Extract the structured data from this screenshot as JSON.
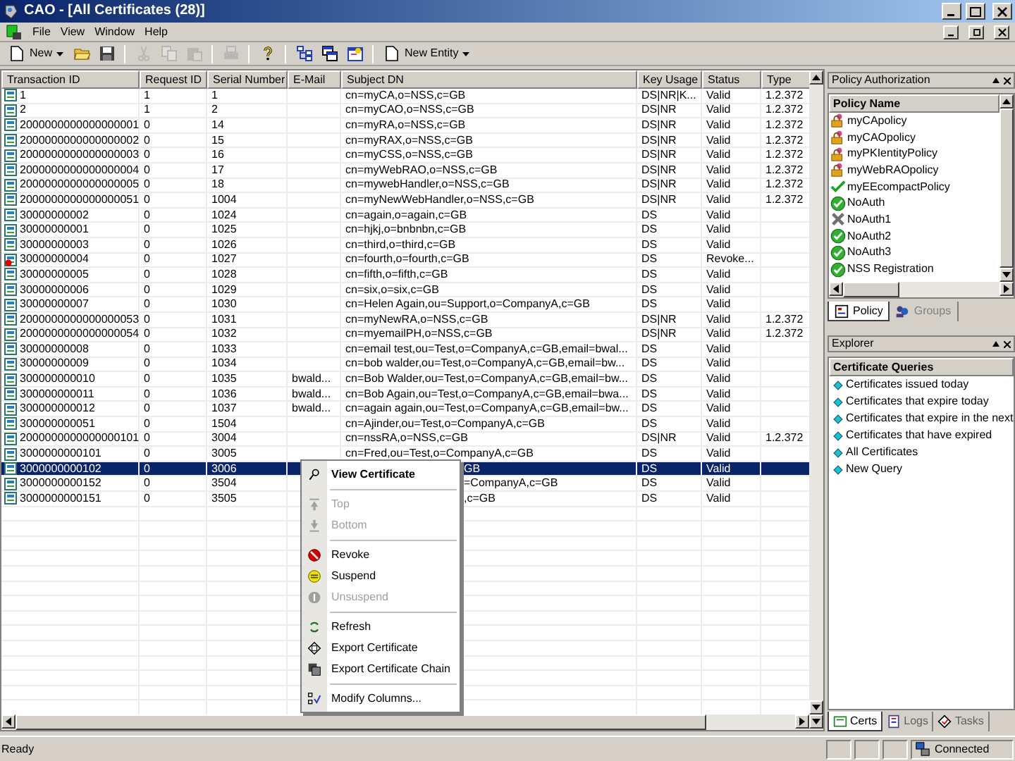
{
  "window": {
    "title": "CAO - [All Certificates (28)]"
  },
  "menu": [
    "File",
    "View",
    "Window",
    "Help"
  ],
  "toolbar": [
    {
      "kind": "new",
      "label": "New",
      "disabled": false
    },
    {
      "kind": "open",
      "disabled": false
    },
    {
      "kind": "save",
      "disabled": false
    },
    {
      "kind": "sep"
    },
    {
      "kind": "cut",
      "disabled": true
    },
    {
      "kind": "copy",
      "disabled": true
    },
    {
      "kind": "paste",
      "disabled": true
    },
    {
      "kind": "sep"
    },
    {
      "kind": "print",
      "disabled": true
    },
    {
      "kind": "sep"
    },
    {
      "kind": "help",
      "disabled": false
    },
    {
      "kind": "sep"
    },
    {
      "kind": "tree",
      "disabled": false
    },
    {
      "kind": "windows",
      "disabled": false
    },
    {
      "kind": "props",
      "disabled": false
    },
    {
      "kind": "sep"
    },
    {
      "kind": "entity",
      "label": "New Entity",
      "disabled": false
    }
  ],
  "table": {
    "columns": [
      "Transaction ID",
      "Request ID",
      "Serial Number",
      "E-Mail",
      "Subject DN",
      "Key Usage",
      "Status",
      "Type"
    ],
    "rows": [
      {
        "cells": [
          "1",
          "1",
          "1",
          "",
          "cn=myCA,o=NSS,c=GB",
          "DS|NR|K...",
          "Valid",
          "1.2.372"
        ],
        "revoked": false,
        "selected": false,
        "partly_hidden": false
      },
      {
        "cells": [
          "2",
          "1",
          "2",
          "",
          "cn=myCAO,o=NSS,c=GB",
          "DS|NR",
          "Valid",
          "1.2.372"
        ],
        "revoked": false,
        "selected": false,
        "partly_hidden": false
      },
      {
        "cells": [
          "2000000000000000001",
          "0",
          "14",
          "",
          "cn=myRA,o=NSS,c=GB",
          "DS|NR",
          "Valid",
          "1.2.372"
        ],
        "revoked": false,
        "selected": false,
        "partly_hidden": false
      },
      {
        "cells": [
          "2000000000000000002",
          "0",
          "15",
          "",
          "cn=myRAX,o=NSS,c=GB",
          "DS|NR",
          "Valid",
          "1.2.372"
        ],
        "revoked": false,
        "selected": false,
        "partly_hidden": false
      },
      {
        "cells": [
          "2000000000000000003",
          "0",
          "16",
          "",
          "cn=myCSS,o=NSS,c=GB",
          "DS|NR",
          "Valid",
          "1.2.372"
        ],
        "revoked": false,
        "selected": false,
        "partly_hidden": false
      },
      {
        "cells": [
          "2000000000000000004",
          "0",
          "17",
          "",
          "cn=myWebRAO,o=NSS,c=GB",
          "DS|NR",
          "Valid",
          "1.2.372"
        ],
        "revoked": false,
        "selected": false,
        "partly_hidden": false
      },
      {
        "cells": [
          "2000000000000000005",
          "0",
          "18",
          "",
          "cn=mywebHandler,o=NSS,c=GB",
          "DS|NR",
          "Valid",
          "1.2.372"
        ],
        "revoked": false,
        "selected": false,
        "partly_hidden": false
      },
      {
        "cells": [
          "2000000000000000051",
          "0",
          "1004",
          "",
          "cn=myNewWebHandler,o=NSS,c=GB",
          "DS|NR",
          "Valid",
          "1.2.372"
        ],
        "revoked": false,
        "selected": false,
        "partly_hidden": false
      },
      {
        "cells": [
          "30000000002",
          "0",
          "1024",
          "",
          "cn=again,o=again,c=GB",
          "DS",
          "Valid",
          ""
        ],
        "revoked": false,
        "selected": false,
        "partly_hidden": false
      },
      {
        "cells": [
          "30000000001",
          "0",
          "1025",
          "",
          "cn=hjkj,o=bnbnbn,c=GB",
          "DS",
          "Valid",
          ""
        ],
        "revoked": false,
        "selected": false,
        "partly_hidden": false
      },
      {
        "cells": [
          "30000000003",
          "0",
          "1026",
          "",
          "cn=third,o=third,c=GB",
          "DS",
          "Valid",
          ""
        ],
        "revoked": false,
        "selected": false,
        "partly_hidden": false
      },
      {
        "cells": [
          "30000000004",
          "0",
          "1027",
          "",
          "cn=fourth,o=fourth,c=GB",
          "DS",
          "Revoke...",
          ""
        ],
        "revoked": true,
        "selected": false,
        "partly_hidden": false
      },
      {
        "cells": [
          "30000000005",
          "0",
          "1028",
          "",
          "cn=fifth,o=fifth,c=GB",
          "DS",
          "Valid",
          ""
        ],
        "revoked": false,
        "selected": false,
        "partly_hidden": false
      },
      {
        "cells": [
          "30000000006",
          "0",
          "1029",
          "",
          "cn=six,o=six,c=GB",
          "DS",
          "Valid",
          ""
        ],
        "revoked": false,
        "selected": false,
        "partly_hidden": false
      },
      {
        "cells": [
          "30000000007",
          "0",
          "1030",
          "",
          "cn=Helen Again,ou=Support,o=CompanyA,c=GB",
          "DS",
          "Valid",
          ""
        ],
        "revoked": false,
        "selected": false,
        "partly_hidden": false
      },
      {
        "cells": [
          "2000000000000000053",
          "0",
          "1031",
          "",
          "cn=myNewRA,o=NSS,c=GB",
          "DS|NR",
          "Valid",
          "1.2.372"
        ],
        "revoked": false,
        "selected": false,
        "partly_hidden": false
      },
      {
        "cells": [
          "2000000000000000054",
          "0",
          "1032",
          "",
          "cn=myemailPH,o=NSS,c=GB",
          "DS|NR",
          "Valid",
          "1.2.372"
        ],
        "revoked": false,
        "selected": false,
        "partly_hidden": false
      },
      {
        "cells": [
          "30000000008",
          "0",
          "1033",
          "",
          "cn=email test,ou=Test,o=CompanyA,c=GB,email=bwal...",
          "DS",
          "Valid",
          ""
        ],
        "revoked": false,
        "selected": false,
        "partly_hidden": false
      },
      {
        "cells": [
          "30000000009",
          "0",
          "1034",
          "",
          "cn=bob walder,ou=Test,o=CompanyA,c=GB,email=bw...",
          "DS",
          "Valid",
          ""
        ],
        "revoked": false,
        "selected": false,
        "partly_hidden": false
      },
      {
        "cells": [
          "300000000010",
          "0",
          "1035",
          "bwald...",
          "cn=Bob Walder,ou=Test,o=CompanyA,c=GB,email=bw...",
          "DS",
          "Valid",
          ""
        ],
        "revoked": false,
        "selected": false,
        "partly_hidden": false
      },
      {
        "cells": [
          "300000000011",
          "0",
          "1036",
          "bwald...",
          "cn=Bob Again,ou=Test,o=CompanyA,c=GB,email=bwa...",
          "DS",
          "Valid",
          ""
        ],
        "revoked": false,
        "selected": false,
        "partly_hidden": false
      },
      {
        "cells": [
          "300000000012",
          "0",
          "1037",
          "bwald...",
          "cn=again again,ou=Test,o=CompanyA,c=GB,email=bw...",
          "DS",
          "Valid",
          ""
        ],
        "revoked": false,
        "selected": false,
        "partly_hidden": false
      },
      {
        "cells": [
          "300000000051",
          "0",
          "1504",
          "",
          "cn=Ajinder,ou=Test,o=CompanyA,c=GB",
          "DS",
          "Valid",
          ""
        ],
        "revoked": false,
        "selected": false,
        "partly_hidden": false
      },
      {
        "cells": [
          "2000000000000000101",
          "0",
          "3004",
          "",
          "cn=nssRA,o=NSS,c=GB",
          "DS|NR",
          "Valid",
          "1.2.372"
        ],
        "revoked": false,
        "selected": false,
        "partly_hidden": false
      },
      {
        "cells": [
          "3000000000101",
          "0",
          "3005",
          "",
          "cn=Fred,ou=Test,o=CompanyA,c=GB",
          "DS",
          "Valid",
          ""
        ],
        "revoked": false,
        "selected": false,
        "partly_hidden": false
      },
      {
        "cells": [
          "3000000000102",
          "0",
          "3006",
          "",
          "GB",
          "DS",
          "Valid",
          ""
        ],
        "revoked": false,
        "selected": true,
        "partly_hidden": true
      },
      {
        "cells": [
          "3000000000152",
          "0",
          "3504",
          "",
          "=CompanyA,c=GB",
          "DS",
          "Valid",
          ""
        ],
        "revoked": false,
        "selected": false,
        "partly_hidden": true
      },
      {
        "cells": [
          "3000000000151",
          "0",
          "3505",
          "",
          ",c=GB",
          "DS",
          "Valid",
          ""
        ],
        "revoked": false,
        "selected": false,
        "partly_hidden": true
      }
    ]
  },
  "context_menu": [
    {
      "kind": "view",
      "label": "View Certificate",
      "default": true,
      "disabled": false
    },
    {
      "kind": "sep"
    },
    {
      "kind": "top",
      "label": "Top",
      "default": false,
      "disabled": true
    },
    {
      "kind": "bottom",
      "label": "Bottom",
      "default": false,
      "disabled": true
    },
    {
      "kind": "sep"
    },
    {
      "kind": "revoke",
      "label": "Revoke",
      "default": false,
      "disabled": false
    },
    {
      "kind": "suspend",
      "label": "Suspend",
      "default": false,
      "disabled": false
    },
    {
      "kind": "unsuspend",
      "label": "Unsuspend",
      "default": false,
      "disabled": true
    },
    {
      "kind": "sep"
    },
    {
      "kind": "refresh",
      "label": "Refresh",
      "default": false,
      "disabled": false
    },
    {
      "kind": "export",
      "label": "Export Certificate",
      "default": false,
      "disabled": false
    },
    {
      "kind": "chain",
      "label": "Export Certificate Chain",
      "default": false,
      "disabled": false
    },
    {
      "kind": "sep"
    },
    {
      "kind": "columns",
      "label": "Modify Columns...",
      "default": false,
      "disabled": false
    }
  ],
  "policy_panel": {
    "title": "Policy Authorization",
    "column": "Policy Name",
    "items": [
      {
        "kind": "lock",
        "label": "myCApolicy"
      },
      {
        "kind": "lock",
        "label": "myCAOpolicy"
      },
      {
        "kind": "lock",
        "label": "myPKIentityPolicy"
      },
      {
        "kind": "lock",
        "label": "myWebRAOpolicy"
      },
      {
        "kind": "tick",
        "label": "myEEcompactPolicy"
      },
      {
        "kind": "ok",
        "label": "NoAuth"
      },
      {
        "kind": "cross",
        "label": "NoAuth1"
      },
      {
        "kind": "ok",
        "label": "NoAuth2"
      },
      {
        "kind": "ok",
        "label": "NoAuth3"
      },
      {
        "kind": "ok",
        "label": "NSS Registration"
      }
    ],
    "tabs": [
      {
        "label": "Policy",
        "selected": true
      },
      {
        "label": "Groups",
        "selected": false
      }
    ]
  },
  "explorer_panel": {
    "title": "Explorer",
    "heading": "Certificate Queries",
    "items": [
      "Certificates issued today",
      "Certificates that expire today",
      "Certificates that expire in the next",
      "Certificates that have expired",
      "All Certificates",
      "New Query"
    ]
  },
  "bottom_tabs": [
    {
      "label": "Certs",
      "selected": true
    },
    {
      "label": "Logs",
      "selected": false
    },
    {
      "label": "Tasks",
      "selected": false
    }
  ],
  "status_bar": {
    "text": "Ready",
    "connection": "Connected"
  }
}
